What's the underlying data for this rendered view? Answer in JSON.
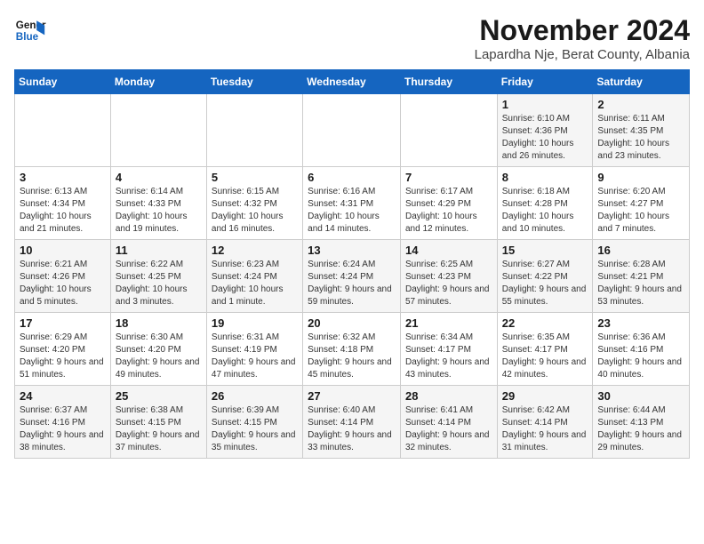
{
  "logo": {
    "line1": "General",
    "line2": "Blue"
  },
  "title": "November 2024",
  "location": "Lapardha Nje, Berat County, Albania",
  "days_of_week": [
    "Sunday",
    "Monday",
    "Tuesday",
    "Wednesday",
    "Thursday",
    "Friday",
    "Saturday"
  ],
  "weeks": [
    [
      {
        "day": "",
        "info": ""
      },
      {
        "day": "",
        "info": ""
      },
      {
        "day": "",
        "info": ""
      },
      {
        "day": "",
        "info": ""
      },
      {
        "day": "",
        "info": ""
      },
      {
        "day": "1",
        "info": "Sunrise: 6:10 AM\nSunset: 4:36 PM\nDaylight: 10 hours and 26 minutes."
      },
      {
        "day": "2",
        "info": "Sunrise: 6:11 AM\nSunset: 4:35 PM\nDaylight: 10 hours and 23 minutes."
      }
    ],
    [
      {
        "day": "3",
        "info": "Sunrise: 6:13 AM\nSunset: 4:34 PM\nDaylight: 10 hours and 21 minutes."
      },
      {
        "day": "4",
        "info": "Sunrise: 6:14 AM\nSunset: 4:33 PM\nDaylight: 10 hours and 19 minutes."
      },
      {
        "day": "5",
        "info": "Sunrise: 6:15 AM\nSunset: 4:32 PM\nDaylight: 10 hours and 16 minutes."
      },
      {
        "day": "6",
        "info": "Sunrise: 6:16 AM\nSunset: 4:31 PM\nDaylight: 10 hours and 14 minutes."
      },
      {
        "day": "7",
        "info": "Sunrise: 6:17 AM\nSunset: 4:29 PM\nDaylight: 10 hours and 12 minutes."
      },
      {
        "day": "8",
        "info": "Sunrise: 6:18 AM\nSunset: 4:28 PM\nDaylight: 10 hours and 10 minutes."
      },
      {
        "day": "9",
        "info": "Sunrise: 6:20 AM\nSunset: 4:27 PM\nDaylight: 10 hours and 7 minutes."
      }
    ],
    [
      {
        "day": "10",
        "info": "Sunrise: 6:21 AM\nSunset: 4:26 PM\nDaylight: 10 hours and 5 minutes."
      },
      {
        "day": "11",
        "info": "Sunrise: 6:22 AM\nSunset: 4:25 PM\nDaylight: 10 hours and 3 minutes."
      },
      {
        "day": "12",
        "info": "Sunrise: 6:23 AM\nSunset: 4:24 PM\nDaylight: 10 hours and 1 minute."
      },
      {
        "day": "13",
        "info": "Sunrise: 6:24 AM\nSunset: 4:24 PM\nDaylight: 9 hours and 59 minutes."
      },
      {
        "day": "14",
        "info": "Sunrise: 6:25 AM\nSunset: 4:23 PM\nDaylight: 9 hours and 57 minutes."
      },
      {
        "day": "15",
        "info": "Sunrise: 6:27 AM\nSunset: 4:22 PM\nDaylight: 9 hours and 55 minutes."
      },
      {
        "day": "16",
        "info": "Sunrise: 6:28 AM\nSunset: 4:21 PM\nDaylight: 9 hours and 53 minutes."
      }
    ],
    [
      {
        "day": "17",
        "info": "Sunrise: 6:29 AM\nSunset: 4:20 PM\nDaylight: 9 hours and 51 minutes."
      },
      {
        "day": "18",
        "info": "Sunrise: 6:30 AM\nSunset: 4:20 PM\nDaylight: 9 hours and 49 minutes."
      },
      {
        "day": "19",
        "info": "Sunrise: 6:31 AM\nSunset: 4:19 PM\nDaylight: 9 hours and 47 minutes."
      },
      {
        "day": "20",
        "info": "Sunrise: 6:32 AM\nSunset: 4:18 PM\nDaylight: 9 hours and 45 minutes."
      },
      {
        "day": "21",
        "info": "Sunrise: 6:34 AM\nSunset: 4:17 PM\nDaylight: 9 hours and 43 minutes."
      },
      {
        "day": "22",
        "info": "Sunrise: 6:35 AM\nSunset: 4:17 PM\nDaylight: 9 hours and 42 minutes."
      },
      {
        "day": "23",
        "info": "Sunrise: 6:36 AM\nSunset: 4:16 PM\nDaylight: 9 hours and 40 minutes."
      }
    ],
    [
      {
        "day": "24",
        "info": "Sunrise: 6:37 AM\nSunset: 4:16 PM\nDaylight: 9 hours and 38 minutes."
      },
      {
        "day": "25",
        "info": "Sunrise: 6:38 AM\nSunset: 4:15 PM\nDaylight: 9 hours and 37 minutes."
      },
      {
        "day": "26",
        "info": "Sunrise: 6:39 AM\nSunset: 4:15 PM\nDaylight: 9 hours and 35 minutes."
      },
      {
        "day": "27",
        "info": "Sunrise: 6:40 AM\nSunset: 4:14 PM\nDaylight: 9 hours and 33 minutes."
      },
      {
        "day": "28",
        "info": "Sunrise: 6:41 AM\nSunset: 4:14 PM\nDaylight: 9 hours and 32 minutes."
      },
      {
        "day": "29",
        "info": "Sunrise: 6:42 AM\nSunset: 4:14 PM\nDaylight: 9 hours and 31 minutes."
      },
      {
        "day": "30",
        "info": "Sunrise: 6:44 AM\nSunset: 4:13 PM\nDaylight: 9 hours and 29 minutes."
      }
    ]
  ]
}
